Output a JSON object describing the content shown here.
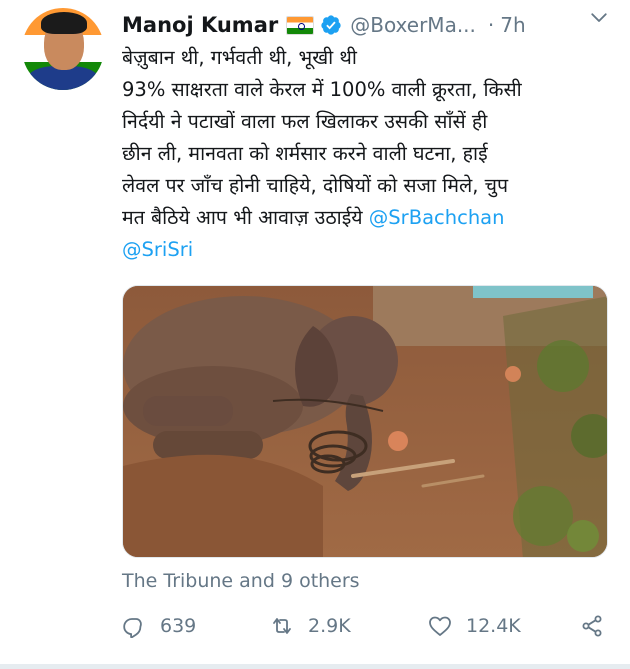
{
  "user": {
    "display_name": "Manoj Kumar",
    "handle": "@BoxerMa...",
    "time": "7h",
    "separator": "·"
  },
  "tweet": {
    "lines": [
      "बेज़ुबान थी, गर्भवती थी, भूखी थी",
      "93% साक्षरता वाले केरल में 100% वाली क्रूरता, किसी",
      "निर्दयी ने पटाखों वाला फल खिलाकर उसकी साँसें ही",
      "छीन ली, मानवता को शर्मसार करने वाली घटना, हाई",
      "लेवल पर जाँच होनी चाहिये, दोषियों को सजा मिले, चुप"
    ],
    "line6_text": "मत बैठिये आप भी आवाज़ उठाईये ",
    "mention_1": "@SrBachchan",
    "mention_2": "@SriSri"
  },
  "source": {
    "label": "The Tribune and 9 others"
  },
  "actions": {
    "reply_count": "639",
    "retweet_count": "2.9K",
    "like_count": "12.4K"
  },
  "colors": {
    "accent": "#1da1f2",
    "muted": "#657786",
    "text": "#14171a"
  },
  "icons": [
    "flag-india-icon",
    "verified-badge-icon",
    "chevron-down-icon",
    "reply-icon",
    "retweet-icon",
    "like-icon",
    "share-icon"
  ]
}
